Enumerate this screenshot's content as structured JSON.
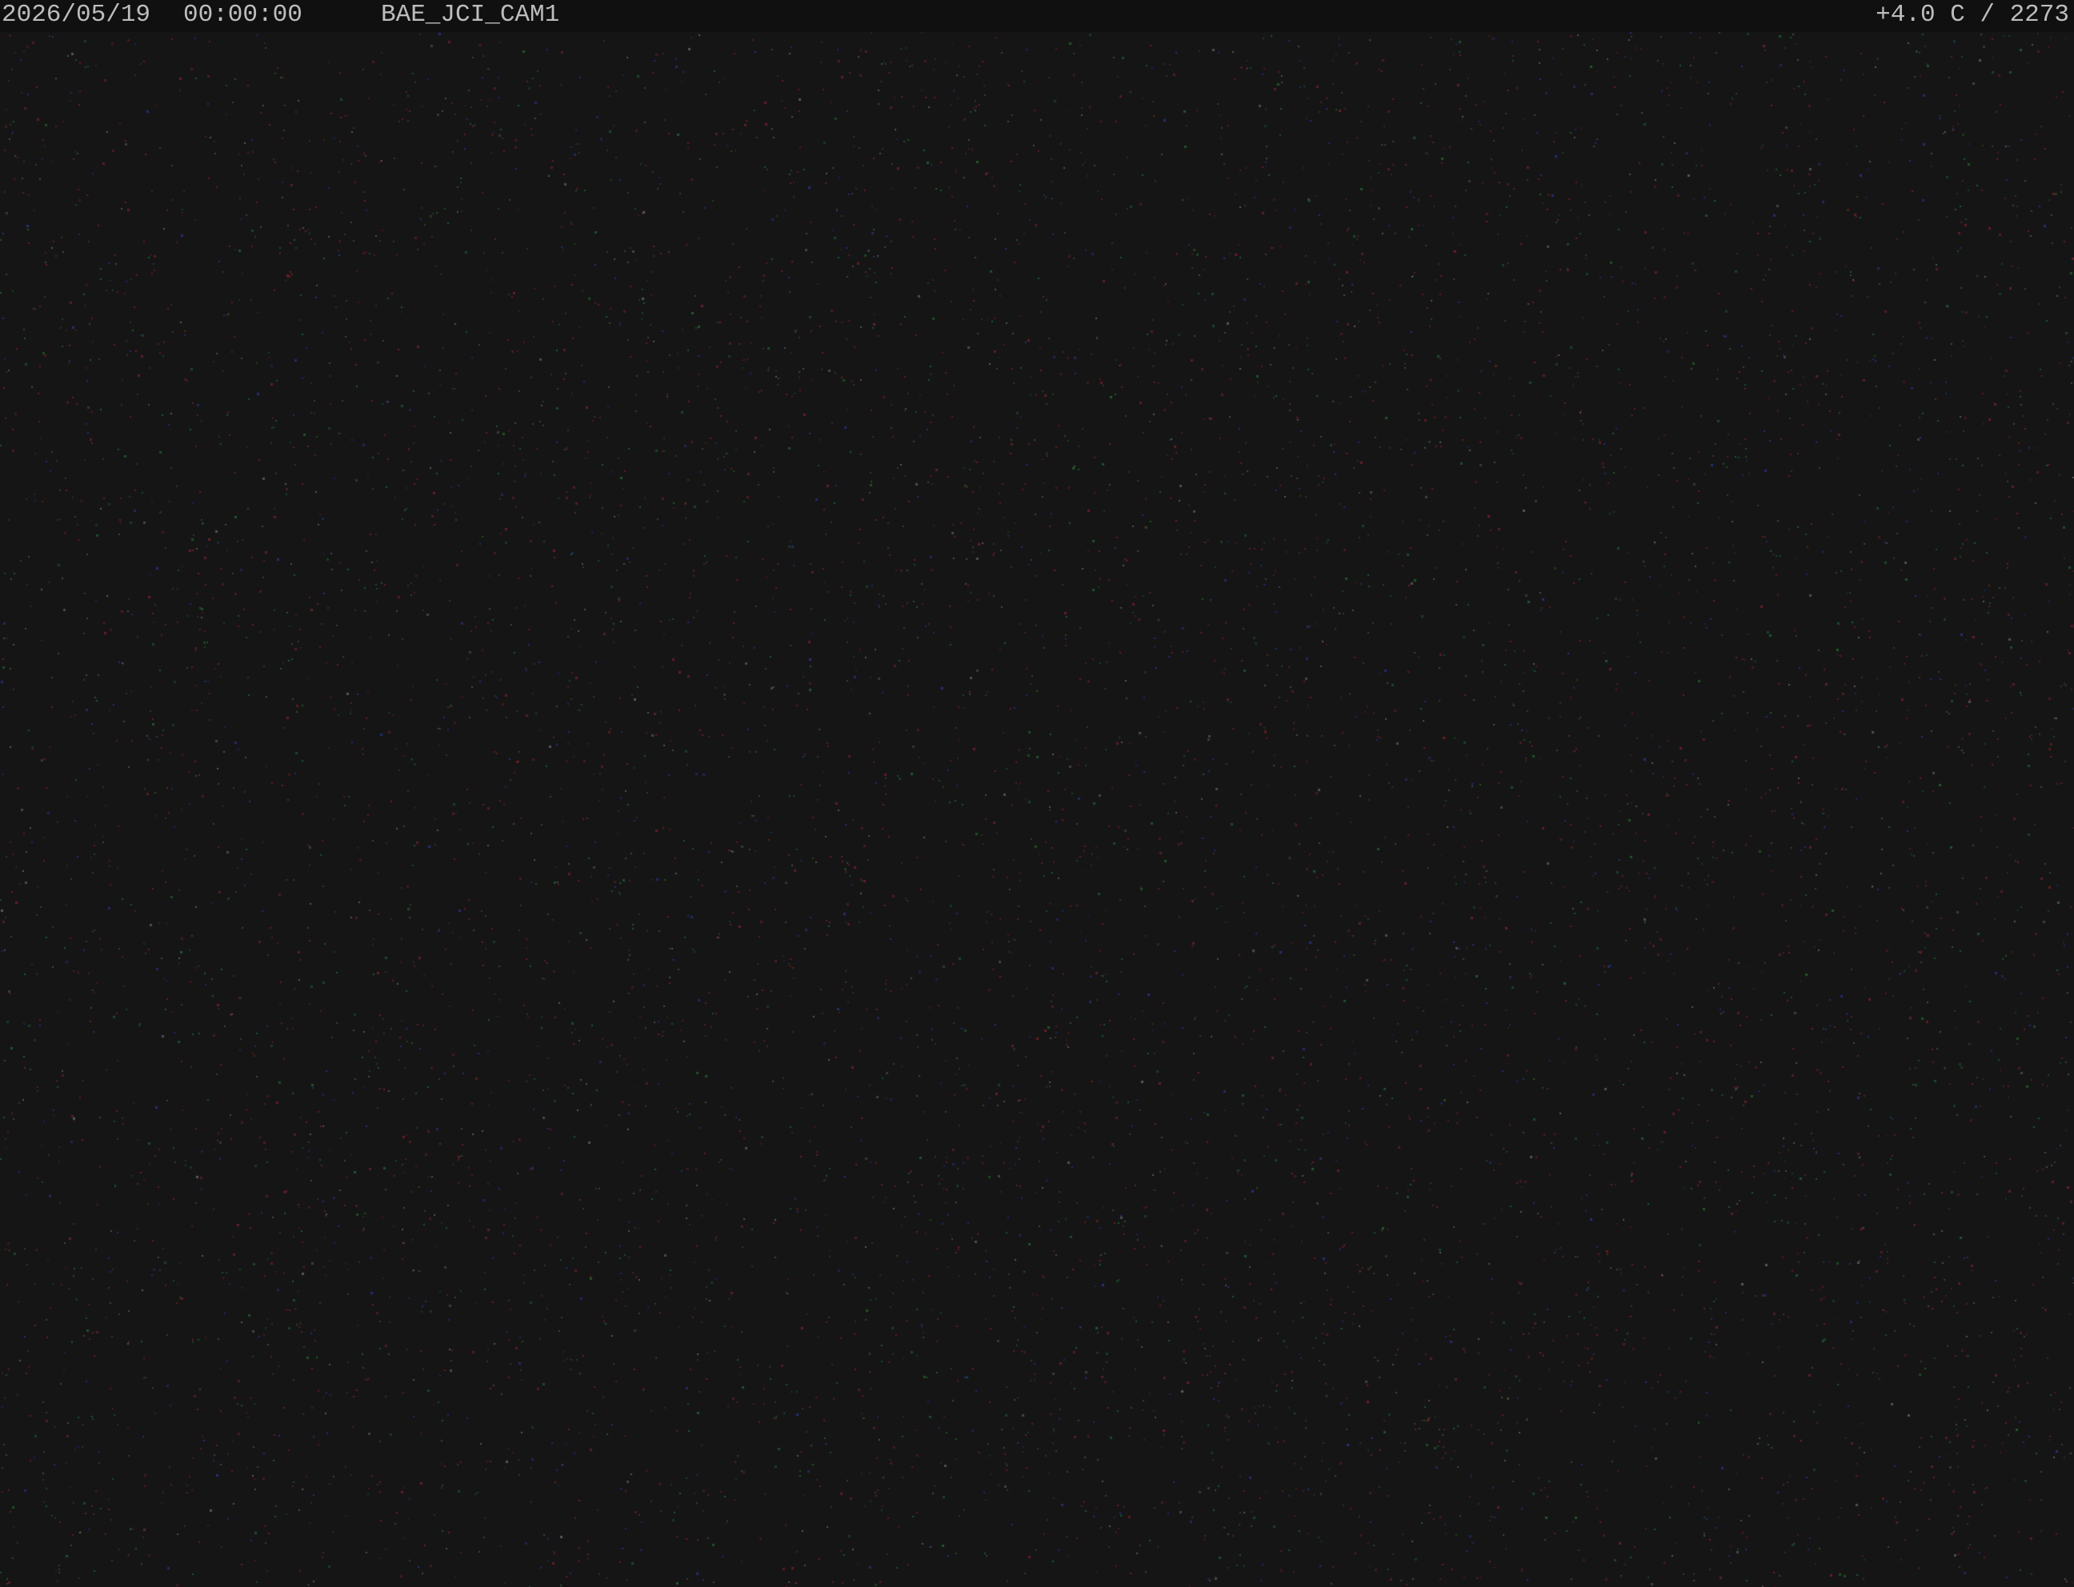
{
  "overlay": {
    "date": "2026/05/19",
    "time": "00:00:00",
    "camera_name": "BAE_JCI_CAM1",
    "status": "+4.0 C / 2273"
  },
  "scene": {
    "description_type": "night-sky-noise",
    "background_color": "#151516",
    "noise_colors": [
      "#6a1f24",
      "#1f5a2a",
      "#26307a",
      "#5a5a5a"
    ]
  }
}
